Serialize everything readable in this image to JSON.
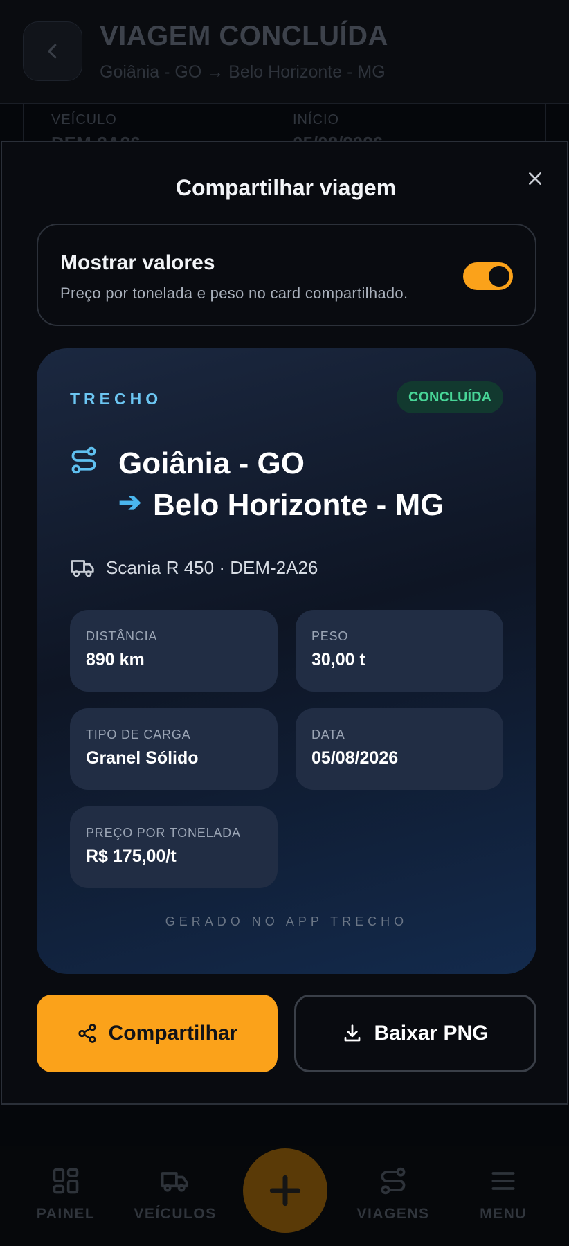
{
  "background": {
    "title": "VIAGEM CONCLUÍDA",
    "subtitle": "Goiânia - GO → Belo Horizonte - MG",
    "fields": [
      {
        "label": "VEÍCULO",
        "value": "DEM-2A26"
      },
      {
        "label": "INÍCIO",
        "value": "05/08/2026"
      }
    ]
  },
  "modal": {
    "title": "Compartilhar viagem",
    "toggle": {
      "title": "Mostrar valores",
      "description": "Preço por tonelada e peso no card compartilhado.",
      "enabled": true
    },
    "card": {
      "brand": "TRECHO",
      "status": "CONCLUÍDA",
      "origin": "Goiânia - GO",
      "arrow": "➔",
      "destination": "Belo Horizonte - MG",
      "vehicle": "Scania R 450 · DEM-2A26",
      "stats": [
        {
          "label": "DISTÂNCIA",
          "value": "890 km"
        },
        {
          "label": "PESO",
          "value": "30,00 t"
        },
        {
          "label": "TIPO DE CARGA",
          "value": "Granel Sólido"
        },
        {
          "label": "DATA",
          "value": "05/08/2026"
        },
        {
          "label": "PREÇO POR TONELADA",
          "value": "R$ 175,00/t"
        }
      ],
      "footer": "GERADO NO APP TRECHO"
    },
    "share_label": "Compartilhar",
    "download_label": "Baixar PNG"
  },
  "nav": {
    "items": [
      {
        "label": "PAINEL",
        "icon": "grid-icon"
      },
      {
        "label": "VEÍCULOS",
        "icon": "truck-icon"
      },
      {
        "label": "VIAGENS",
        "icon": "route-icon"
      },
      {
        "label": "MENU",
        "icon": "menu-icon"
      }
    ],
    "fab_icon": "plus-icon"
  },
  "colors": {
    "accent": "#fba21a",
    "route_blue": "#4ab6ee",
    "success_green": "#48d597"
  }
}
